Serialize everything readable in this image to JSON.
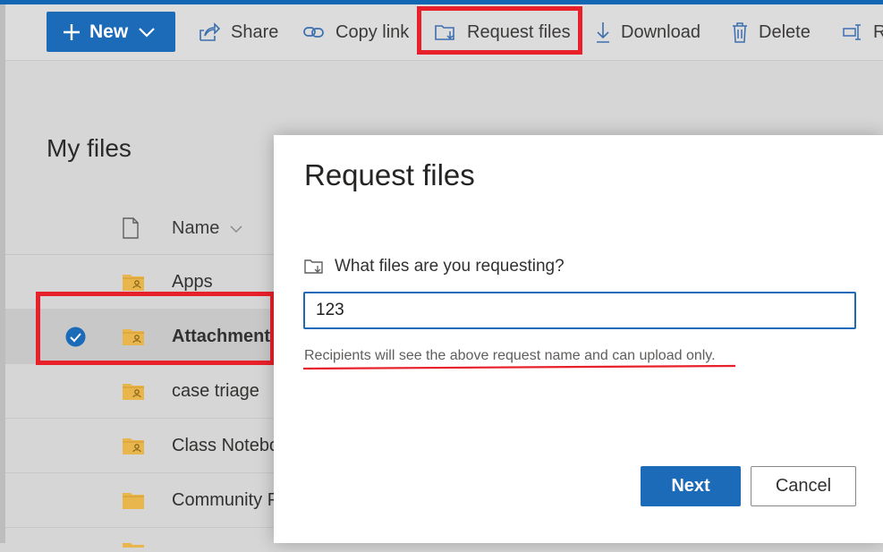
{
  "toolbar": {
    "new_label": "New",
    "items": [
      {
        "label": "Share",
        "icon": "share-icon"
      },
      {
        "label": "Copy link",
        "icon": "link-icon"
      },
      {
        "label": "Request files",
        "icon": "request-files-icon"
      },
      {
        "label": "Download",
        "icon": "download-icon"
      },
      {
        "label": "Delete",
        "icon": "delete-icon"
      },
      {
        "label": "R",
        "icon": "rename-icon"
      }
    ]
  },
  "files": {
    "title": "My files",
    "column_name": "Name",
    "rows": [
      {
        "name": "Apps",
        "selected": false
      },
      {
        "name": "Attachment",
        "selected": true
      },
      {
        "name": "case triage",
        "selected": false
      },
      {
        "name": "Class Notebo",
        "selected": false
      },
      {
        "name": "Community P",
        "selected": false
      }
    ]
  },
  "dialog": {
    "title": "Request files",
    "question": "What files are you requesting?",
    "input_value": "123",
    "hint": "Recipients will see the above request name and can upload only.",
    "next_label": "Next",
    "cancel_label": "Cancel"
  },
  "colors": {
    "accent": "#1c6bb8",
    "highlight": "#e8202a",
    "folder": "#e8b64c"
  }
}
